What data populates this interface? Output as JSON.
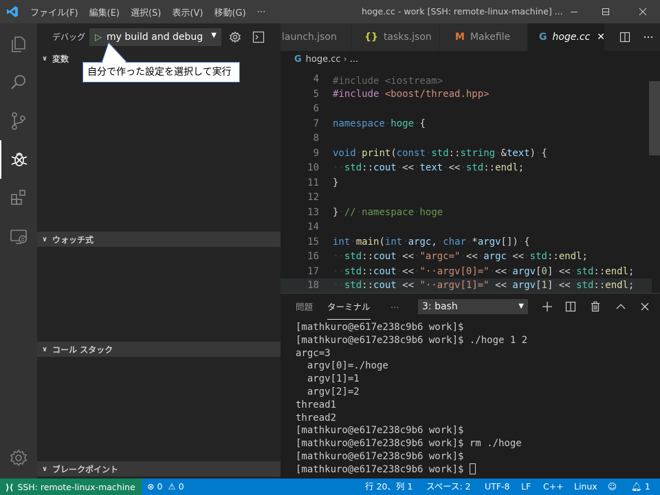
{
  "titlebar": {
    "menu": [
      "ファイル(F)",
      "編集(E)",
      "選択(S)",
      "表示(V)",
      "移動(G)",
      "⋯"
    ],
    "title": "hoge.cc - work [SSH: remote-linux-machine] ..."
  },
  "debug": {
    "label": "デバッグ",
    "config": "my build and debug"
  },
  "sections": {
    "variables": "変数",
    "watch": "ウォッチ式",
    "callstack": "コール スタック",
    "breakpoints": "ブレークポイント"
  },
  "callout": "自分で作った設定を選択して実行",
  "tabs": [
    {
      "label": "launch.json",
      "icon": ""
    },
    {
      "label": "tasks.json",
      "icon": "{}"
    },
    {
      "label": "Makefile",
      "icon": "M"
    },
    {
      "label": "hoge.cc",
      "icon": "G"
    }
  ],
  "breadcrumb": {
    "file": "hoge.cc",
    "rest": "..."
  },
  "code": {
    "partial_top": "#include <iostream>",
    "line_numbers": [
      "4",
      "5",
      "6",
      "7",
      "8",
      "9",
      "10",
      "11",
      "12",
      "13",
      "14",
      "15",
      "16",
      "17",
      "18"
    ]
  },
  "panel": {
    "tabs": [
      "問題",
      "ターミナル",
      "⋯"
    ],
    "terminal_select": "3: bash",
    "terminal_lines": [
      "[mathkuro@e617e238c9b6 work]$",
      "[mathkuro@e617e238c9b6 work]$ ./hoge 1 2",
      "argc=3",
      "  argv[0]=./hoge",
      "  argv[1]=1",
      "  argv[2]=2",
      "thread1",
      "thread2",
      "[mathkuro@e617e238c9b6 work]$",
      "[mathkuro@e617e238c9b6 work]$ rm ./hoge",
      "[mathkuro@e617e238c9b6 work]$",
      "[mathkuro@e617e238c9b6 work]$ "
    ]
  },
  "status": {
    "remote": "SSH: remote-linux-machine",
    "errors": "0",
    "warnings": "0",
    "position": "行 20、列 1",
    "spaces": "スペース: 2",
    "encoding": "UTF-8",
    "eol": "LF",
    "language": "C++",
    "os": "Linux",
    "notifications": "1"
  },
  "colors": {
    "statusbar": "#007acc",
    "remote": "#16825d",
    "titlebar": "#3c3c3c",
    "activitybar": "#333333",
    "sidebar": "#252526",
    "editor": "#1e1e1e"
  }
}
